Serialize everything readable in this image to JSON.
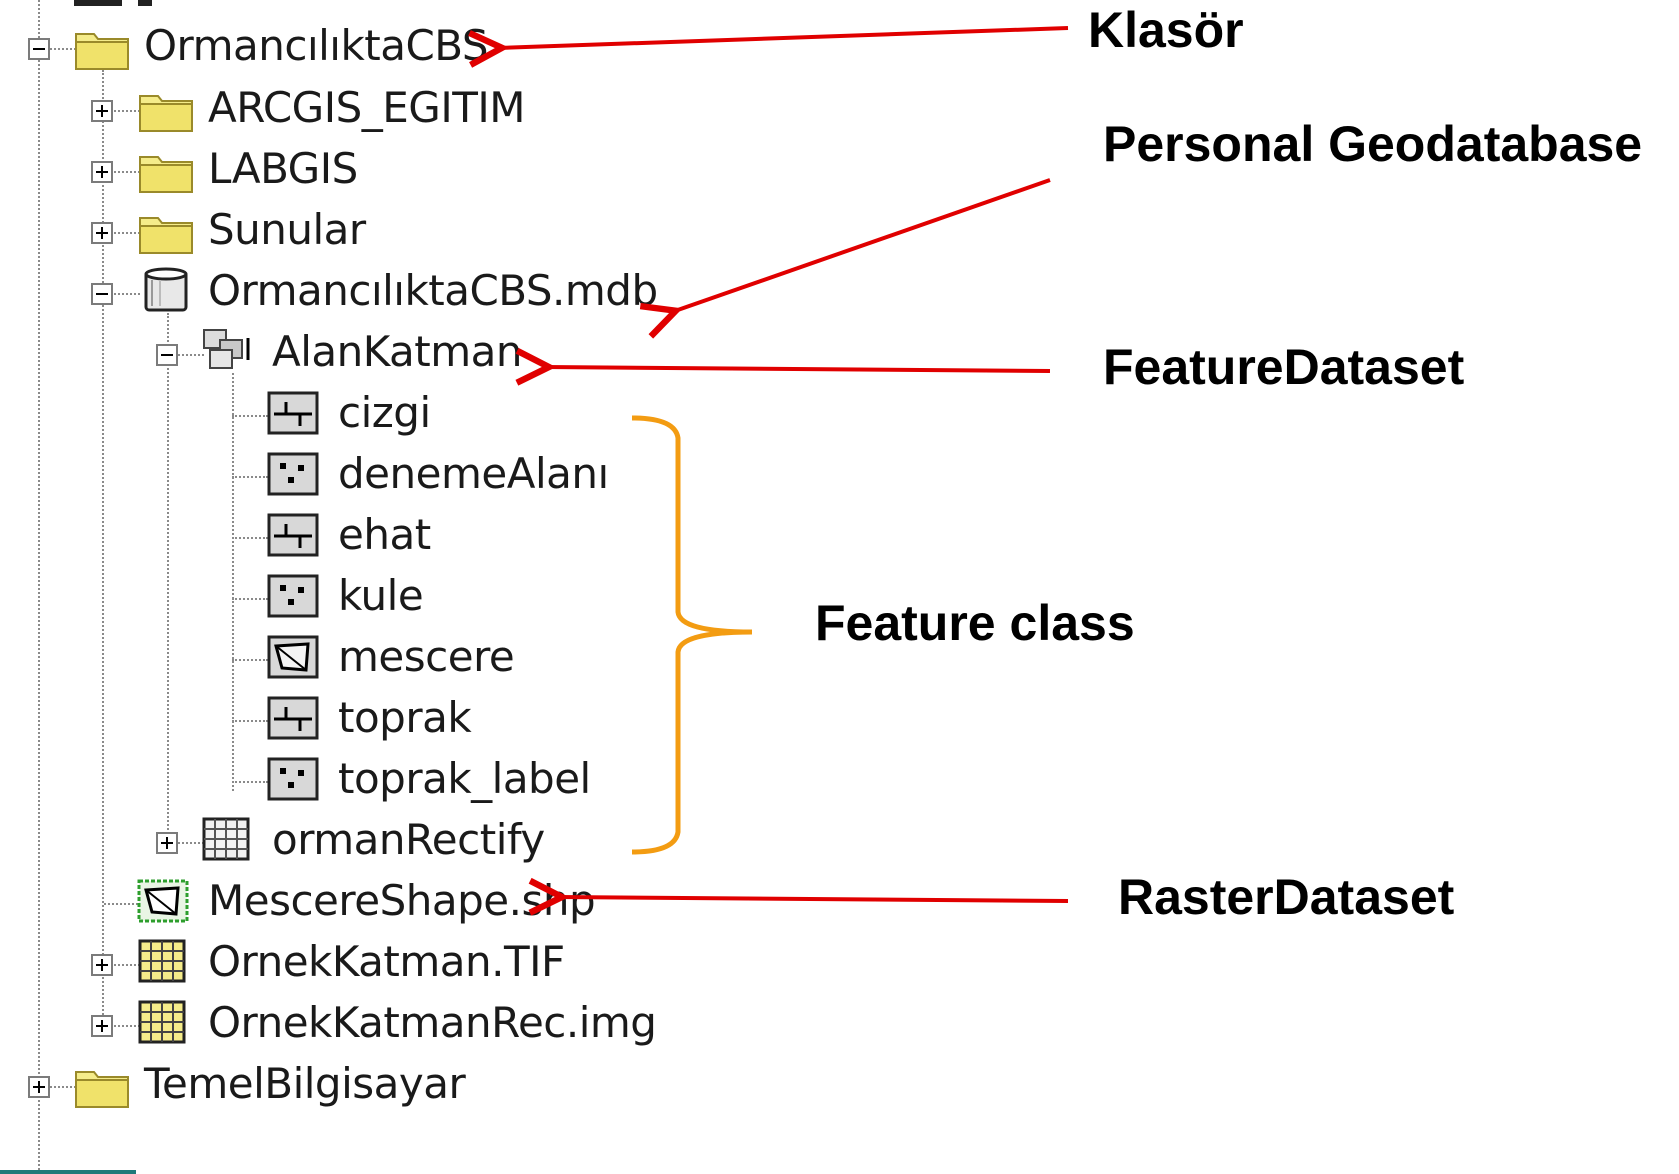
{
  "tree": {
    "root_folder": {
      "label": "OrmancılıktaCBS",
      "icon": "folder-icon",
      "state": "expanded"
    },
    "children": [
      {
        "label": "ARCGIS_EGITIM",
        "icon": "folder-icon",
        "state": "collapsed"
      },
      {
        "label": "LABGIS",
        "icon": "folder-icon",
        "state": "collapsed"
      },
      {
        "label": "Sunular",
        "icon": "folder-icon",
        "state": "collapsed"
      },
      {
        "label": "OrmancılıktaCBS.mdb",
        "icon": "personal-geodatabase-icon",
        "state": "expanded"
      },
      {
        "label": "MescereShape.shp",
        "icon": "shapefile-polygon-icon"
      },
      {
        "label": "OrnekKatman.TIF",
        "icon": "raster-icon",
        "state": "collapsed"
      },
      {
        "label": "OrnekKatmanRec.img",
        "icon": "raster-icon",
        "state": "collapsed"
      }
    ],
    "geodatabase_children": [
      {
        "label": "AlanKatman",
        "icon": "feature-dataset-icon",
        "state": "expanded"
      },
      {
        "label": "ormanRectify",
        "icon": "raster-dataset-icon",
        "state": "collapsed"
      }
    ],
    "feature_classes": [
      {
        "label": "cizgi",
        "icon": "line-feature-class-icon"
      },
      {
        "label": "denemeAlanı",
        "icon": "point-feature-class-icon"
      },
      {
        "label": "ehat",
        "icon": "line-feature-class-icon"
      },
      {
        "label": "kule",
        "icon": "point-feature-class-icon"
      },
      {
        "label": "mescere",
        "icon": "polygon-feature-class-icon"
      },
      {
        "label": "toprak",
        "icon": "line-feature-class-icon"
      },
      {
        "label": "toprak_label",
        "icon": "point-feature-class-icon"
      }
    ],
    "next_root_folder": {
      "label": "TemelBilgisayar",
      "icon": "folder-icon",
      "state": "collapsed"
    }
  },
  "annotations": {
    "folder": "Klasör",
    "personal_geodatabase": "Personal Geodatabase",
    "feature_dataset": "FeatureDataset",
    "feature_class": "Feature class",
    "raster_dataset": "RasterDataset"
  },
  "colors": {
    "arrow": "#e00000",
    "brace": "#f39c12",
    "folder_fill": "#f5ec8a",
    "tree_lines": "#8a8a8a",
    "bottom_accent": "#1d7a7a"
  }
}
